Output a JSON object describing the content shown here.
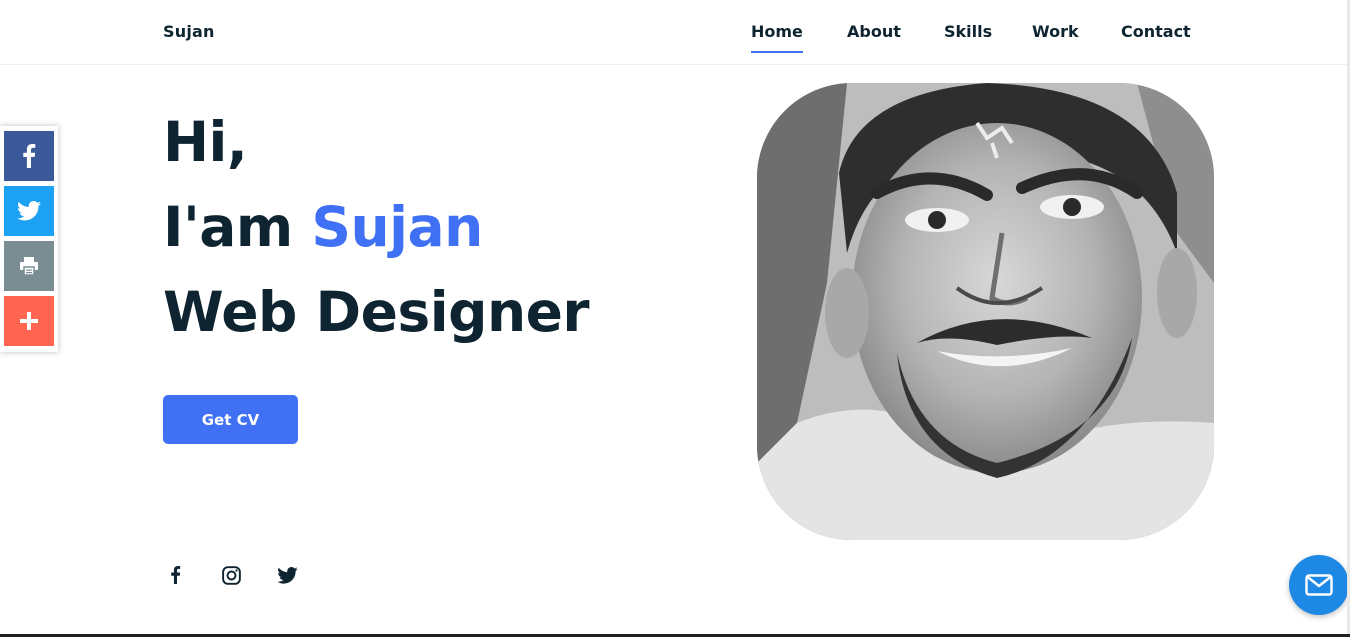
{
  "header": {
    "brand": "Sujan",
    "nav": [
      {
        "label": "Home",
        "active": true
      },
      {
        "label": "About",
        "active": false
      },
      {
        "label": "Skills",
        "active": false
      },
      {
        "label": "Work",
        "active": false
      },
      {
        "label": "Contact",
        "active": false
      }
    ]
  },
  "share_bar": {
    "icons": [
      "facebook-icon",
      "twitter-icon",
      "print-icon",
      "plus-icon"
    ],
    "colors": {
      "facebook": "#3b5998",
      "twitter": "#1da1f2",
      "print": "#7a8d93",
      "more": "#ff6550"
    }
  },
  "hero": {
    "line1": "Hi,",
    "line2_prefix": "I'am ",
    "name": "Sujan",
    "role": "Web Designer",
    "cv_button": "Get CV",
    "accent_color": "#4070f4",
    "text_color": "#0e2431"
  },
  "social": {
    "icons": [
      "facebook-icon",
      "instagram-icon",
      "twitter-icon"
    ]
  },
  "photo": {
    "subject": "portrait photo of Sujan (black and white)"
  },
  "fab": {
    "icon": "mail-icon",
    "color": "#1e88e5"
  }
}
